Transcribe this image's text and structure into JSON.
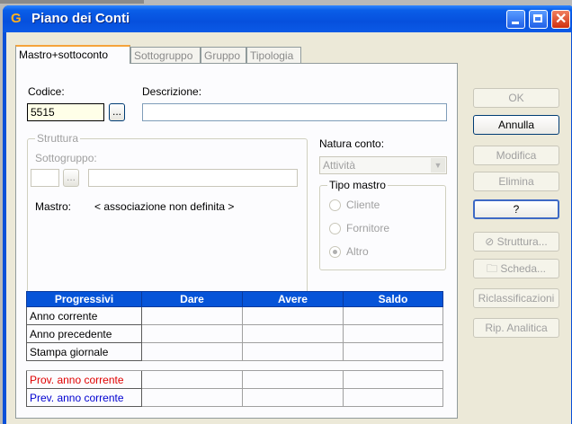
{
  "window": {
    "title": "Piano dei Conti",
    "app_icon": "G"
  },
  "tabs": [
    "Mastro+sottoconto",
    "Sottogruppo",
    "Gruppo",
    "Tipologia"
  ],
  "form": {
    "codice_label": "Codice:",
    "codice_value": "5515",
    "descrizione_label": "Descrizione:",
    "descrizione_value": "",
    "lookup_button": "...",
    "struttura": {
      "title": "Struttura",
      "sottogruppo_label": "Sottogruppo:",
      "sottogruppo_value": "",
      "mastro_label": "Mastro:",
      "mastro_value": "< associazione non definita >"
    },
    "natura": {
      "label": "Natura conto:",
      "selected": "Attività"
    },
    "tipo_mastro": {
      "title": "Tipo mastro",
      "options": [
        "Cliente",
        "Fornitore",
        "Altro"
      ],
      "selected": "Altro"
    }
  },
  "table": {
    "headers": [
      "Progressivi",
      "Dare",
      "Avere",
      "Saldo"
    ],
    "rows": [
      "Anno corrente",
      "Anno precedente",
      "Stampa giornale"
    ],
    "extra_rows": [
      "Prov. anno corrente",
      "Prev. anno corrente"
    ]
  },
  "buttons": [
    "OK",
    "Annulla",
    "Modifica",
    "Elimina",
    "?",
    "Struttura...",
    "Scheda...",
    "Riclassificazioni",
    "Rip. Analitica"
  ],
  "colors": {
    "title_bar": "#0a50d8",
    "tab_highlight": "#f5a33a",
    "table_header": "#0654d8",
    "prov_text": "#e00000",
    "prev_text": "#0000d0"
  }
}
